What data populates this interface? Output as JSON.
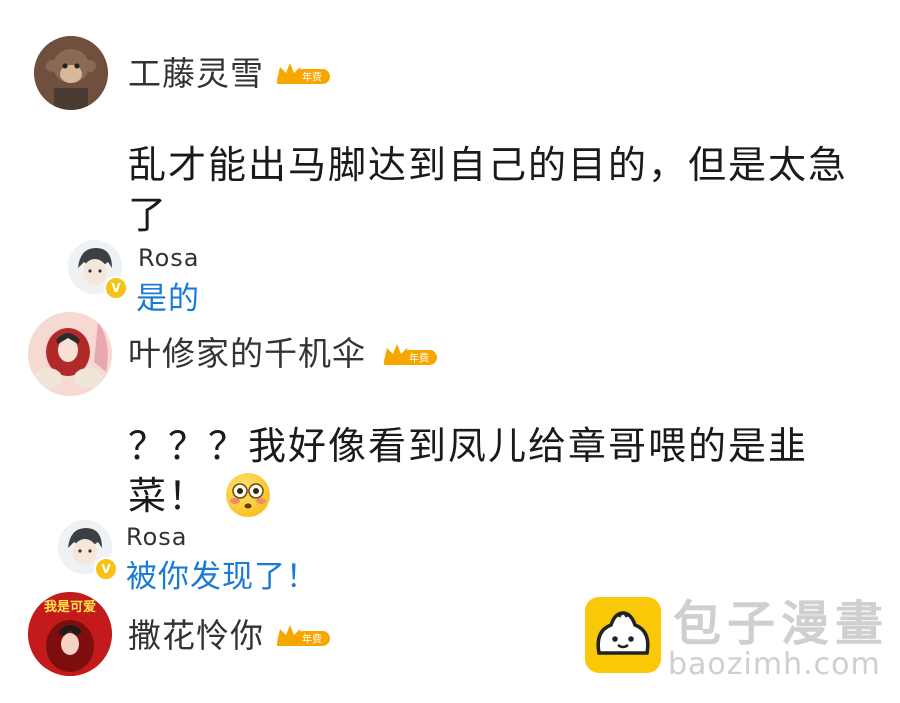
{
  "comments": [
    {
      "user": "工藤灵雪",
      "badge": "年费",
      "text": "乱才能出马脚达到自己的目的，但是太急了",
      "reply": {
        "user": "Rosa",
        "text": "是的",
        "verified": true
      }
    },
    {
      "user": "叶修家的千机伞",
      "badge": "年费",
      "text": "？？？我好像看到凤儿给章哥喂的是韭菜！",
      "emoji": "flushed-face-emoji",
      "reply": {
        "user": "Rosa",
        "text": "被你发现了！",
        "verified": true
      }
    },
    {
      "user": "撒花怜你",
      "badge": "年费",
      "avatar_text": "我是可爱"
    }
  ],
  "verify_mark": "V",
  "watermark": {
    "title": "包子漫畫",
    "url": "baozimh.com"
  },
  "colors": {
    "reply_blue": "#1a7bd6",
    "badge_gold": "#f7a600",
    "watermark_yellow": "#f9c807"
  }
}
